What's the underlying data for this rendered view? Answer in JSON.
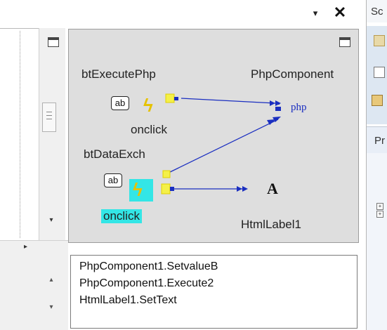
{
  "window": {
    "pin_glyph": "▾",
    "close_glyph": "✕"
  },
  "diagram": {
    "source1": {
      "name": "btExecutePhp",
      "event": "onclick",
      "icon": "ab"
    },
    "source2": {
      "name": "btDataExch",
      "event": "onclick",
      "icon": "ab"
    },
    "target1": {
      "name": "PhpComponent",
      "label": "php"
    },
    "target2": {
      "name": "HtmlLabel1",
      "label": "A"
    },
    "colors": {
      "link": "#1a2ec0",
      "pin": "#f4f048",
      "selected": "#33e6e6",
      "canvas": "#dedede"
    }
  },
  "methods": [
    "PhpComponent1.SetvalueB",
    "PhpComponent1.Execute2",
    "HtmlLabel1.SetText"
  ],
  "right_panels": {
    "solution_title": "Sc",
    "properties_title": "Pr"
  }
}
